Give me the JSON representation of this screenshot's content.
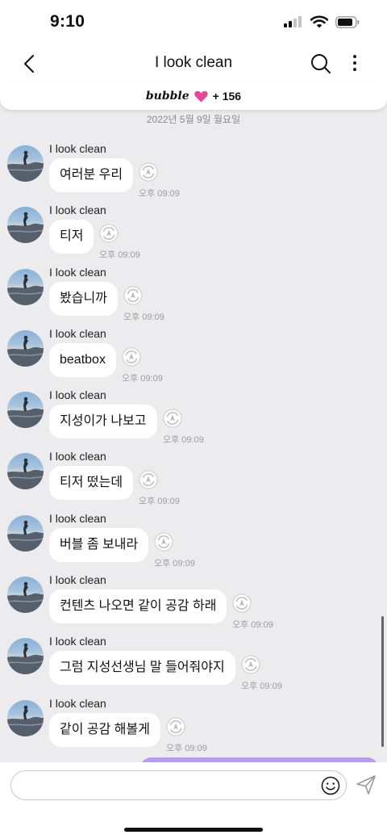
{
  "status": {
    "time": "9:10"
  },
  "nav": {
    "title": "I look clean"
  },
  "banner": {
    "logo": "bubble",
    "count": "+ 156",
    "accent": "#e6469a"
  },
  "date_separator": "2022년 5월 9일 월요일",
  "messages": [
    {
      "sender": "I look clean",
      "text": "여러분 우리",
      "time": "오후 09:09"
    },
    {
      "sender": "I look clean",
      "text": "티저",
      "time": "오후 09:09"
    },
    {
      "sender": "I look clean",
      "text": "봤습니까",
      "time": "오후 09:09"
    },
    {
      "sender": "I look clean",
      "text": "beatbox",
      "time": "오후 09:09"
    },
    {
      "sender": "I look clean",
      "text": "지성이가 나보고",
      "time": "오후 09:09"
    },
    {
      "sender": "I look clean",
      "text": "티저 떴는데",
      "time": "오후 09:09"
    },
    {
      "sender": "I look clean",
      "text": "버블 좀 보내라",
      "time": "오후 09:09"
    },
    {
      "sender": "I look clean",
      "text": "컨텐츠 나오면 같이 공감 하래",
      "time": "오후 09:09"
    },
    {
      "sender": "I look clean",
      "text": "그럼 지성선생님 말 들어줘야지",
      "time": "오후 09:09"
    },
    {
      "sender": "I look clean",
      "text": "같이 공감 해볼게",
      "time": "오후 09:09"
    }
  ],
  "input": {
    "placeholder": "",
    "value": ""
  },
  "colors": {
    "background": "#ececee",
    "own_bubble": "#b49df5"
  }
}
